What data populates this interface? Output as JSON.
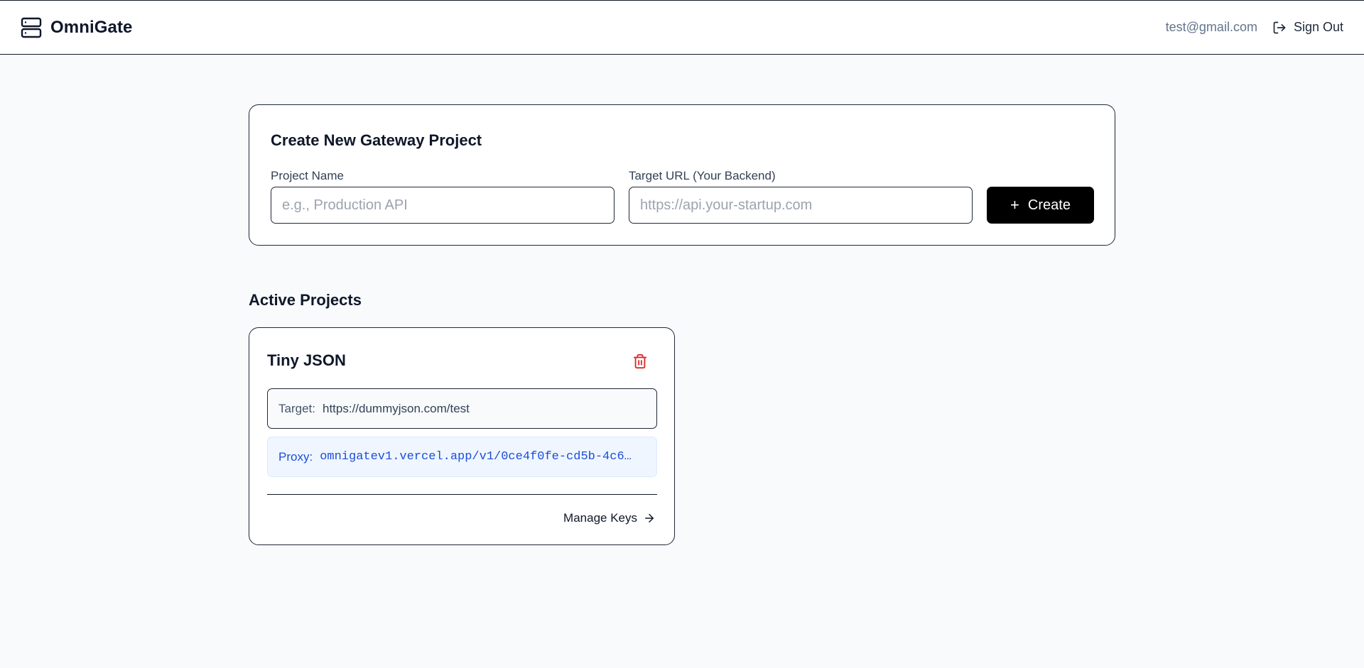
{
  "header": {
    "app_name": "OmniGate",
    "logo_icon": "server-icon",
    "user_email": "test@gmail.com",
    "sign_out_label": "Sign Out",
    "sign_out_icon": "log-out-icon"
  },
  "create_project": {
    "title": "Create New Gateway Project",
    "project_name": {
      "label": "Project Name",
      "value": "",
      "placeholder": "e.g., Production API"
    },
    "target_url": {
      "label": "Target URL (Your Backend)",
      "value": "",
      "placeholder": "https://api.your-startup.com"
    },
    "create_button": {
      "icon": "+",
      "label": "Create"
    }
  },
  "active_projects": {
    "title": "Active Projects",
    "projects": [
      {
        "name": "Tiny JSON",
        "delete_icon": "trash-icon",
        "target_label": "Target:",
        "target_url": "https://dummyjson.com/test",
        "proxy_label": "Proxy:",
        "proxy_url": "omnigatev1.vercel.app/v1/0ce4f0fe-cd5b-4c6…",
        "manage_label": "Manage Keys",
        "manage_icon": "arrow-right-icon"
      }
    ]
  },
  "colors": {
    "background": "#f8fafc",
    "primary_button": "#000000",
    "proxy_text": "#1d4ed8",
    "proxy_background": "#eff6ff",
    "delete_icon": "#dc2626",
    "muted_text": "#64748b"
  }
}
